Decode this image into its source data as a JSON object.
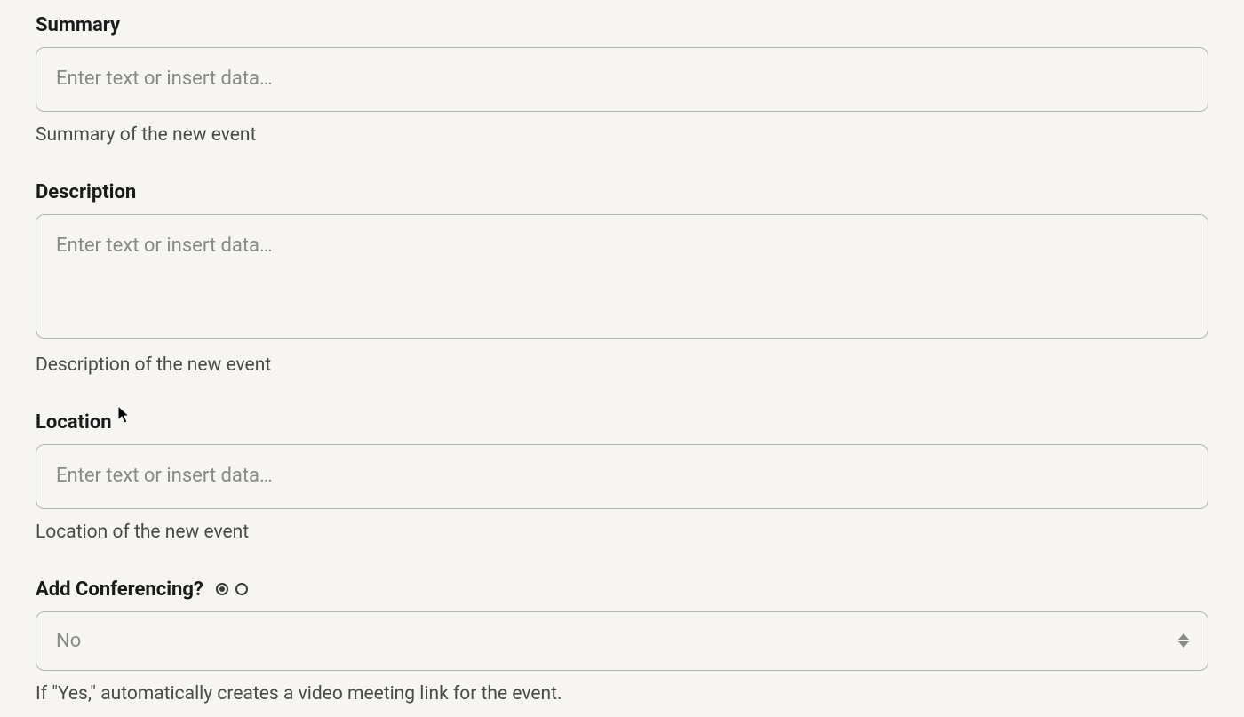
{
  "summary": {
    "label": "Summary",
    "placeholder": "Enter text or insert data…",
    "value": "",
    "helper": "Summary of the new event"
  },
  "description": {
    "label": "Description",
    "placeholder": "Enter text or insert data…",
    "value": "",
    "helper": "Description of the new event"
  },
  "location": {
    "label": "Location",
    "placeholder": "Enter text or insert data…",
    "value": "",
    "helper": "Location of the new event"
  },
  "conferencing": {
    "label": "Add Conferencing?",
    "selected": "No",
    "helper": "If \"Yes,\" automatically creates a video meeting link for the event."
  }
}
